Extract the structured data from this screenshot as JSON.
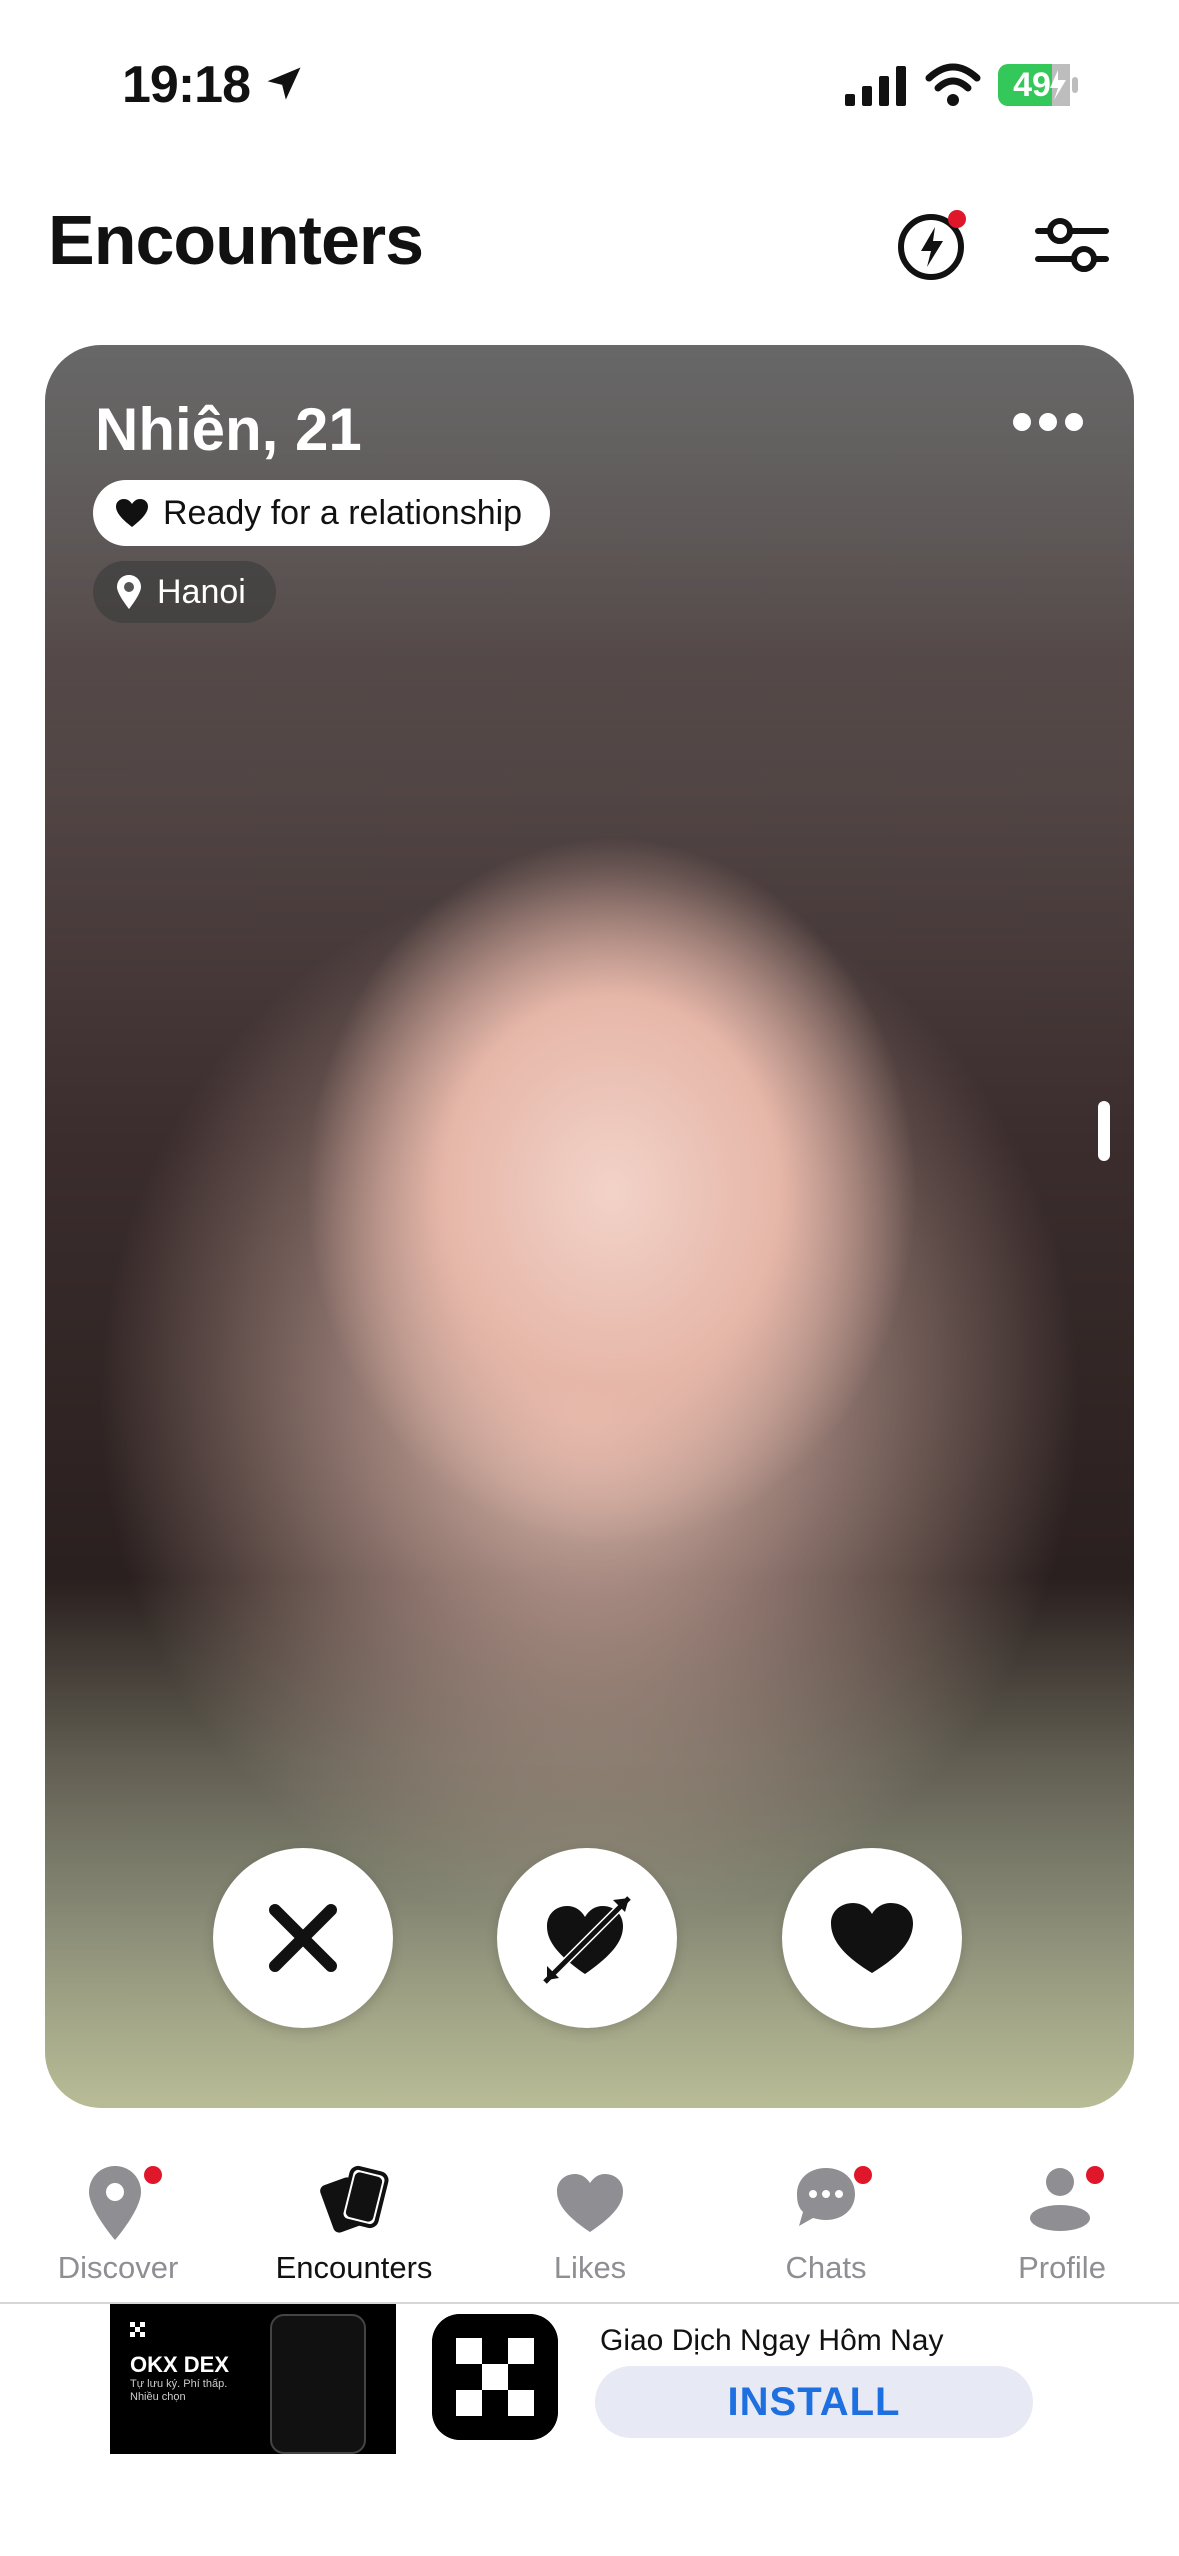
{
  "status_bar": {
    "time": "19:18",
    "battery": "49"
  },
  "header": {
    "title": "Encounters"
  },
  "profile_card": {
    "name_age": "Nhiên, 21",
    "relationship": "Ready for a relationship",
    "location": "Hanoi"
  },
  "tab_bar": {
    "items": [
      {
        "label": "Discover",
        "icon": "discover-pin-icon",
        "badge": true
      },
      {
        "label": "Encounters",
        "icon": "cards-icon",
        "badge": false,
        "active": true
      },
      {
        "label": "Likes",
        "icon": "heart-icon",
        "badge": false
      },
      {
        "label": "Chats",
        "icon": "chat-bubble-icon",
        "badge": true
      },
      {
        "label": "Profile",
        "icon": "person-icon",
        "badge": true
      }
    ]
  },
  "ad": {
    "brand": "OKX DEX",
    "tagline": "Tự lưu ký. Phí thấp. Nhiều chọn",
    "headline": "Giao Dịch Ngay Hôm Nay",
    "install_label": "INSTALL"
  },
  "colors": {
    "badge_red": "#e0162b",
    "install_text": "#1e6fe0",
    "install_bg": "#e7e9f4",
    "battery_green": "#34c759"
  }
}
